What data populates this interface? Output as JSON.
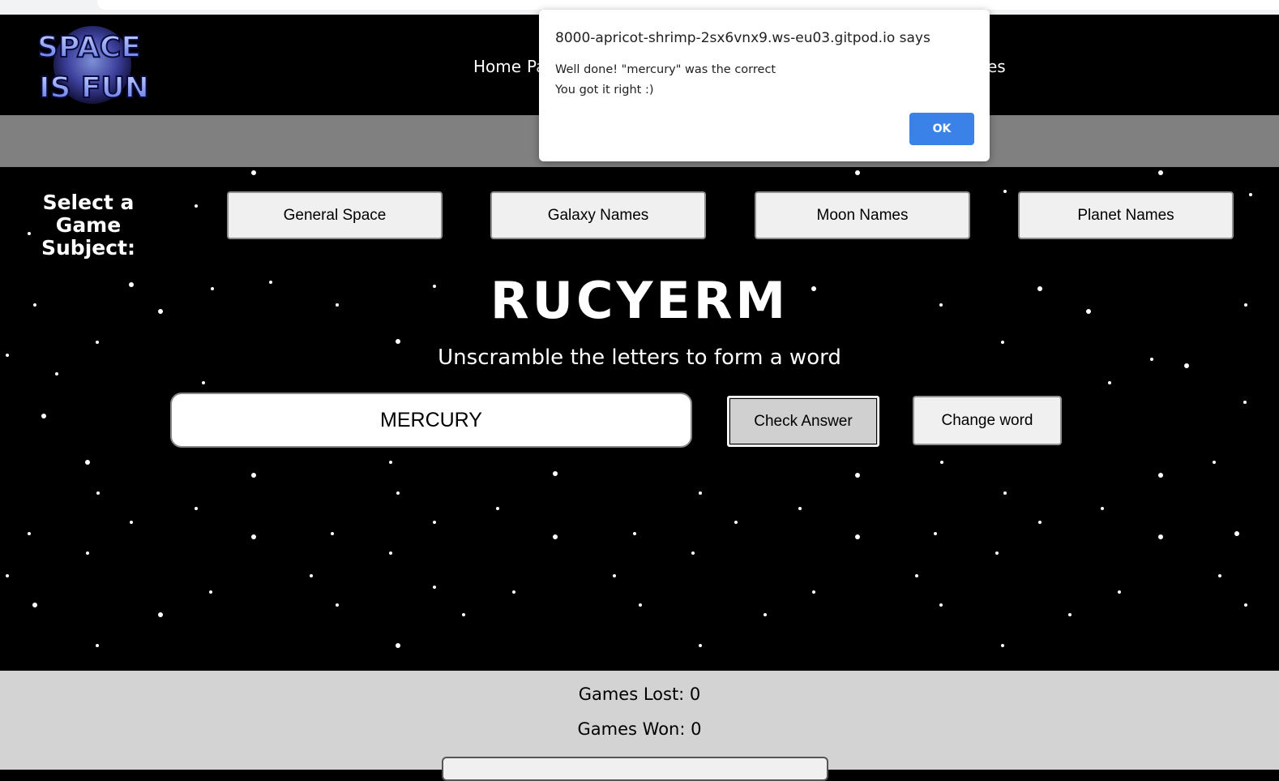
{
  "dialog": {
    "origin": "8000-apricot-shrimp-2sx6vnx9.ws-eu03.gitpod.io says",
    "message_line1": "Well done! \"mercury\" was the correct",
    "message_line2": "You got it right :)",
    "ok_label": "OK",
    "ok_color": "#3b82e8"
  },
  "logo": {
    "line1": "SPACE",
    "line2": "IS FUN"
  },
  "nav": {
    "home": "Home",
    "partial_left": "Pa",
    "partial_right": "es"
  },
  "subject": {
    "label": "Select a Game Subject:",
    "buttons": [
      "General Space",
      "Galaxy Names",
      "Moon Names",
      "Planet Names"
    ]
  },
  "game": {
    "scrambled_word": "RUCYERM",
    "instruction": "Unscramble the letters to form a word",
    "answer_value": "MERCURY",
    "check_label": "Check Answer",
    "change_label": "Change word"
  },
  "scores": {
    "lost": "Games Lost: 0",
    "won": "Games Won: 0"
  }
}
